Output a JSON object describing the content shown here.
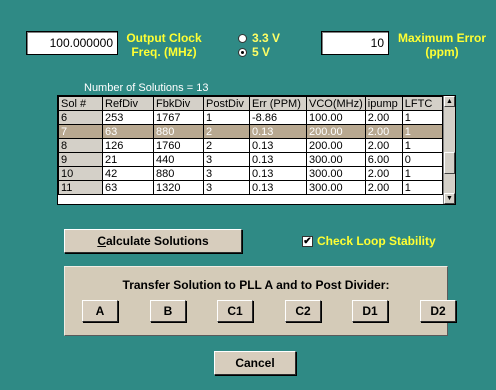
{
  "output_clock": {
    "value": "100.000000",
    "label_line1": "Output  Clock",
    "label_line2": "Freq. (MHz)"
  },
  "voltage": {
    "option1": "3.3 V",
    "option2": "5 V",
    "selected": "5 V"
  },
  "max_error": {
    "value": "10",
    "label_line1": "Maximum Error",
    "label_line2": "(ppm)"
  },
  "solutions": {
    "count_text": "Number of Solutions = 13",
    "columns": [
      "Sol #",
      "RefDiv",
      "FbkDiv",
      "PostDiv",
      "Err (PPM)",
      "VCO(MHz)",
      "ipump",
      "LFTC"
    ],
    "rows": [
      [
        "6",
        "253",
        "1767",
        "1",
        "-8.86",
        "100.00",
        "2.00",
        "1"
      ],
      [
        "7",
        "63",
        "880",
        "2",
        "0.13",
        "200.00",
        "2.00",
        "1"
      ],
      [
        "8",
        "126",
        "1760",
        "2",
        "0.13",
        "200.00",
        "2.00",
        "1"
      ],
      [
        "9",
        "21",
        "440",
        "3",
        "0.13",
        "300.00",
        "6.00",
        "0"
      ],
      [
        "10",
        "42",
        "880",
        "3",
        "0.13",
        "300.00",
        "2.00",
        "1"
      ],
      [
        "11",
        "63",
        "1320",
        "3",
        "0.13",
        "300.00",
        "2.00",
        "1"
      ]
    ]
  },
  "calculate": {
    "accel": "C",
    "rest": "alculate Solutions"
  },
  "check_loop": {
    "label": "Check Loop Stability",
    "checked_glyph": "✔"
  },
  "transfer": {
    "title": "Transfer Solution to PLL A and to Post Divider:",
    "buttons": [
      "A",
      "B",
      "C1",
      "C2",
      "D1",
      "D2"
    ]
  },
  "cancel_label": "Cancel"
}
